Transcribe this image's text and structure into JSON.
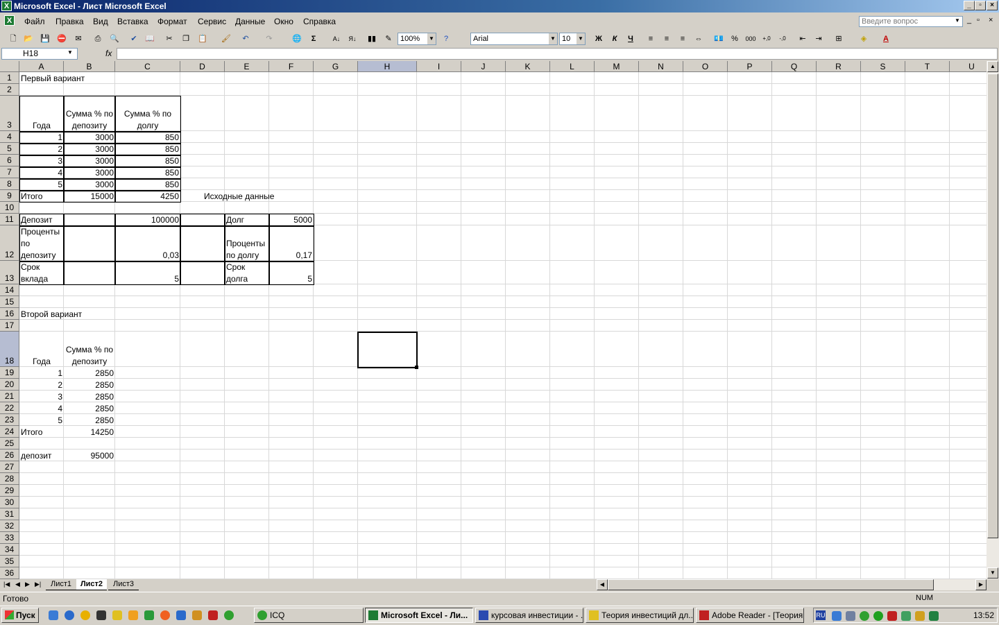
{
  "window": {
    "title": "Microsoft Excel - Лист Microsoft Excel"
  },
  "menu": {
    "items": [
      "Файл",
      "Правка",
      "Вид",
      "Вставка",
      "Формат",
      "Сервис",
      "Данные",
      "Окно",
      "Справка"
    ],
    "ask_placeholder": "Введите вопрос"
  },
  "toolbar": {
    "zoom": "100%",
    "font": "Arial",
    "size": "10",
    "bold": "Ж",
    "italic": "К",
    "underline": "Ч"
  },
  "formula_bar": {
    "name_box": "H18",
    "fx": "fx",
    "value": ""
  },
  "columns": [
    "A",
    "B",
    "C",
    "D",
    "E",
    "F",
    "G",
    "H",
    "I",
    "J",
    "K",
    "L",
    "M",
    "N",
    "O",
    "P",
    "Q",
    "R",
    "S",
    "T",
    "U"
  ],
  "rows": [
    "1",
    "2",
    "3",
    "4",
    "5",
    "6",
    "7",
    "8",
    "9",
    "10",
    "11",
    "12",
    "13",
    "14",
    "15",
    "16",
    "17",
    "18",
    "19",
    "20",
    "21",
    "22",
    "23",
    "24",
    "25",
    "26",
    "27",
    "28",
    "29",
    "30",
    "31",
    "32",
    "33",
    "34",
    "35",
    "36"
  ],
  "sheet": {
    "r1": {
      "a": "Первый вариант"
    },
    "r3": {
      "a": "Года",
      "b": "Сумма % по депозиту",
      "c": "Сумма % по долгу"
    },
    "r4": {
      "a": "1",
      "b": "3000",
      "c": "850"
    },
    "r5": {
      "a": "2",
      "b": "3000",
      "c": "850"
    },
    "r6": {
      "a": "3",
      "b": "3000",
      "c": "850"
    },
    "r7": {
      "a": "4",
      "b": "3000",
      "c": "850"
    },
    "r8": {
      "a": "5",
      "b": "3000",
      "c": "850"
    },
    "r9": {
      "a": "Итого",
      "b": "15000",
      "c": "4250",
      "d": "Исходные данные"
    },
    "r11": {
      "a": "Депозит",
      "c": "100000",
      "e": "Долг",
      "f": "5000"
    },
    "r12": {
      "a": "Проценты по депозиту",
      "c": "0,03",
      "e": "Проценты по долгу",
      "f": "0,17"
    },
    "r13": {
      "a": "Срок вклада",
      "c": "5",
      "e": "Срок долга",
      "f": "5"
    },
    "r16": {
      "a": "Второй вариант"
    },
    "r18": {
      "a": "Года",
      "b": "Сумма % по депозиту"
    },
    "r19": {
      "a": "1",
      "b": "2850"
    },
    "r20": {
      "a": "2",
      "b": "2850"
    },
    "r21": {
      "a": "3",
      "b": "2850"
    },
    "r22": {
      "a": "4",
      "b": "2850"
    },
    "r23": {
      "a": "5",
      "b": "2850"
    },
    "r24": {
      "a": "Итого",
      "b": "14250"
    },
    "r26": {
      "a": "депозит",
      "b": "95000"
    }
  },
  "tabs": [
    "Лист1",
    "Лист2",
    "Лист3"
  ],
  "active_tab": "Лист2",
  "status": {
    "left": "Готово",
    "num": "NUM"
  },
  "taskbar": {
    "start": "Пуск",
    "tasks": [
      "ICQ",
      "Microsoft Excel - Ли...",
      "курсовая инвестиции - ...",
      "Теория инвестиций дл...",
      "Adobe Reader - [Теория..."
    ],
    "lang": "RU",
    "clock": "13:52"
  }
}
